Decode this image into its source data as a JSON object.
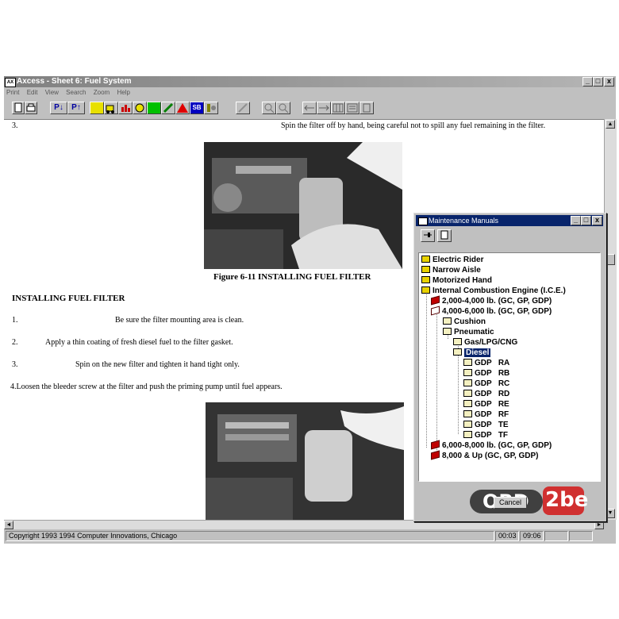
{
  "window": {
    "title": "Axcess -  Sheet 6: Fuel System",
    "app_icon": "axcess-app-icon",
    "caption_buttons": [
      "_",
      "□",
      "x"
    ]
  },
  "menu": [
    "Print",
    "Edit",
    "View",
    "Search",
    "Zoom",
    "Help"
  ],
  "toolbar": {
    "page_up": "P↓",
    "page_top": "P↑",
    "sb_label": "SB"
  },
  "document": {
    "step3_num": "3.",
    "step3_text": "Spin the filter off by hand, being careful not to spill any fuel remaining in the filter.",
    "figure_caption": "Figure 6-11 INSTALLING FUEL FILTER",
    "section_heading": "INSTALLING FUEL FILTER",
    "steps": [
      {
        "num": "1.",
        "text": "Be sure the filter mounting area is clean."
      },
      {
        "num": "2.",
        "text": "Apply a thin coating of fresh diesel fuel to the filter gasket."
      },
      {
        "num": "3.",
        "text": "Spin on the new filter and tighten it hand tight only."
      }
    ],
    "step4": "4.Loosen the bleeder screw at the filter and push the priming pump until fuel appears."
  },
  "status": {
    "copyright": "Copyright 1993 1994 Computer Innovations, Chicago",
    "time1": "00:03",
    "time2": "09:06"
  },
  "dialog": {
    "title": "Maintenance Manuals",
    "caption_buttons": [
      "_",
      "□",
      "x"
    ],
    "cancel_label": "Cancel",
    "tree": {
      "electric_rider": "Electric Rider",
      "narrow_aisle": "Narrow Aisle",
      "motorized_hand": "Motorized Hand",
      "ice": "Internal Combustion Engine (I.C.E.)",
      "cap1": "2,000-4,000 lb. (GC, GP, GDP)",
      "cap2": "4,000-6,000 lb. (GC, GP, GDP)",
      "cushion": "Cushion",
      "pneumatic": "Pneumatic",
      "gas": "Gas/LPG/CNG",
      "diesel": "Diesel",
      "models": [
        "GDP   RA",
        "GDP   RB",
        "GDP   RC",
        "GDP   RD",
        "GDP   RE",
        "GDP   RF",
        "GDP   TE",
        "GDP   TF"
      ],
      "cap3": "6,000-8,000 lb. (GC, GP, GDP)",
      "cap4": "8,000 & Up (GC, GP, GDP)"
    }
  },
  "watermark": {
    "text1": "OBD",
    "text2": "2be"
  }
}
